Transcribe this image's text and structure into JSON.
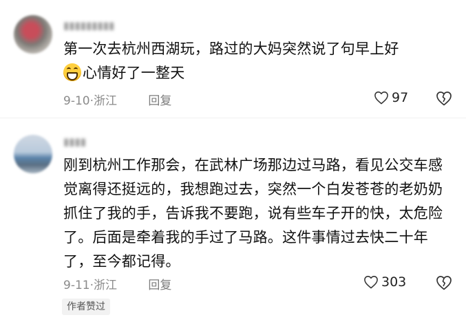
{
  "comments": [
    {
      "username": "▮▮▮▮▮▮▮▮▮",
      "text_main": "第一次去杭州西湖玩，路过的大妈突然说了句早上好",
      "text_emoji": "grinning-face-emoji",
      "text_tail": "心情好了一整天",
      "date": "9-10",
      "location": "浙江",
      "reply_label": "回复",
      "likes": "97"
    },
    {
      "username": "▮▮▮▮",
      "text": "刚到杭州工作那会，在武林广场那边过马路，看见公交车感觉离得还挺远的，我想跑过去，突然一个白发苍苍的老奶奶抓住了我的手，告诉我不要跑，说有些车子开的快，太危险了。后面是牵着我的手过了马路。这件事情过去快二十年了，至今都记得。",
      "date": "9-11",
      "location": "浙江",
      "reply_label": "回复",
      "likes": "303",
      "badge": "作者赞过"
    }
  ],
  "separator": "·",
  "icons": {
    "like": "heart-outline-icon",
    "dislike": "broken-heart-outline-icon"
  },
  "colors": {
    "text": "#111111",
    "meta": "#8a8a8a",
    "badge_bg": "#f2f2f2"
  }
}
